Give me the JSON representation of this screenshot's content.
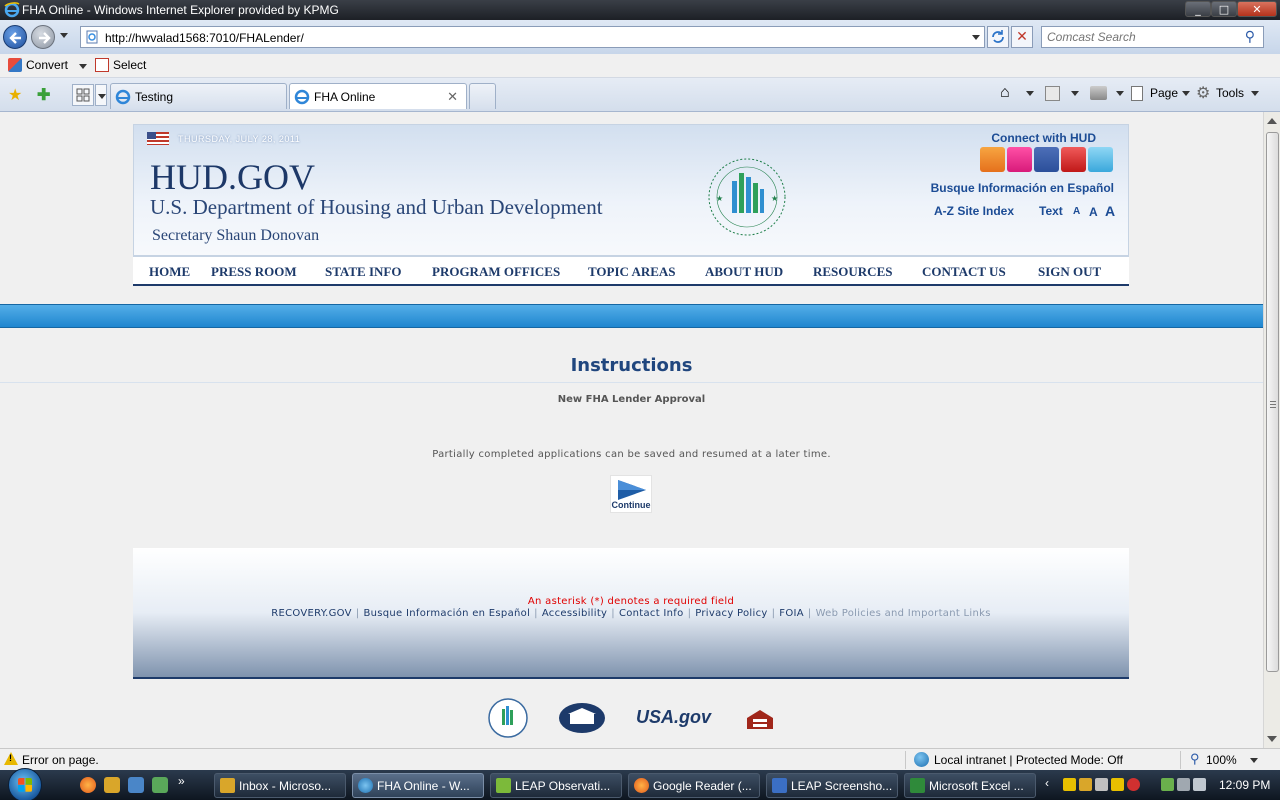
{
  "window": {
    "title": "FHA Online - Windows Internet Explorer provided by KPMG",
    "min": "_",
    "max": "□",
    "close": "✕"
  },
  "address": {
    "url": "http://hwvalad1568:7010/FHALender/",
    "search_placeholder": "Comcast Search"
  },
  "commands": {
    "convert": "Convert",
    "select": "Select"
  },
  "tabs": [
    {
      "label": "Testing"
    },
    {
      "label": "FHA Online"
    }
  ],
  "toolbar": {
    "page": "Page",
    "tools": "Tools"
  },
  "hud": {
    "date": "THURSDAY, JULY 28, 2011",
    "brand": "HUD.GOV",
    "department": "U.S. Department of Housing and Urban Development",
    "secretary": "Secretary Shaun Donovan",
    "connect": "Connect with HUD",
    "espanol": "Busque Información en Español",
    "az_index": "A-Z Site Index",
    "text_label": "Text",
    "text_small": "A",
    "text_medium": "A",
    "text_large": "A",
    "nav": [
      "HOME",
      "PRESS ROOM",
      "STATE INFO",
      "PROGRAM OFFICES",
      "TOPIC AREAS",
      "ABOUT HUD",
      "RESOURCES",
      "CONTACT US",
      "SIGN OUT"
    ]
  },
  "content": {
    "heading": "Instructions",
    "subtitle": "New FHA Lender Approval",
    "note": "Partially completed applications can be saved and resumed at a later time.",
    "continue_label": "Continue"
  },
  "footer": {
    "asterisk_note": "An asterisk (*) denotes a required field",
    "links": [
      "RECOVERY.GOV",
      "Busque Información en Español",
      "Accessibility",
      "Contact Info",
      "Privacy Policy",
      "FOIA"
    ],
    "grey_link": "Web Policies and Important Links",
    "usa_gov": "USA.gov"
  },
  "status": {
    "error": "Error on page.",
    "zone": "Local intranet | Protected Mode: Off",
    "zoom": "100%"
  },
  "taskbar": {
    "items": [
      {
        "label": "Inbox - Microso..."
      },
      {
        "label": "FHA Online - W..."
      },
      {
        "label": "LEAP Observati..."
      },
      {
        "label": "Google Reader (..."
      },
      {
        "label": "LEAP Screensho..."
      },
      {
        "label": "Microsoft Excel ..."
      }
    ],
    "clock": "12:09 PM"
  },
  "colors": {
    "hud_navy": "#1d3a6a",
    "link_blue": "#1c4c95",
    "blue_band": "#1f86cf",
    "required_red": "#e00000"
  }
}
